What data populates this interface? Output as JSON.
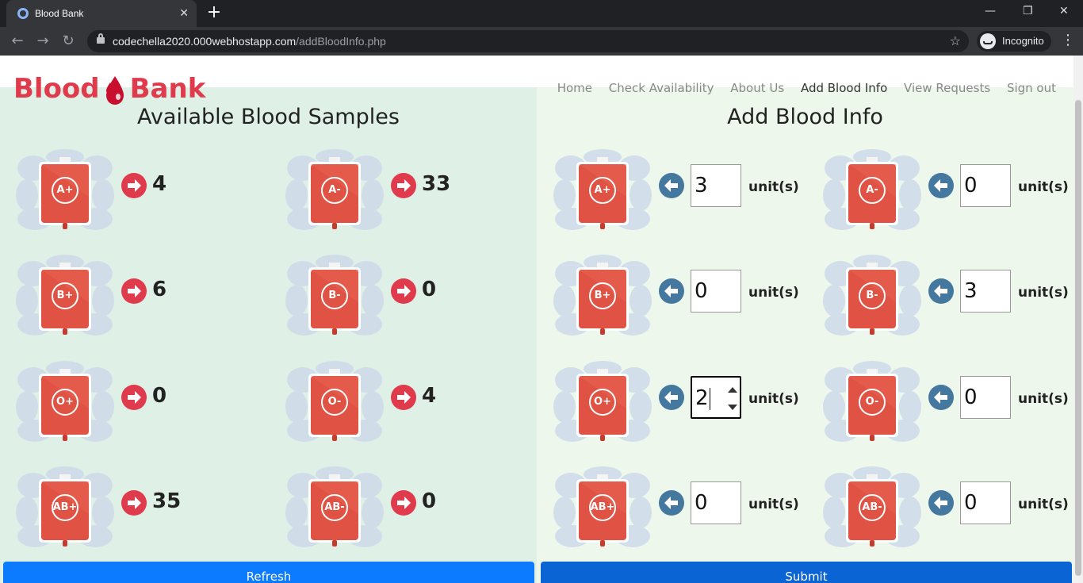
{
  "browser": {
    "tab_title": "Blood Bank",
    "tab_close": "✕",
    "new_tab": "+",
    "url_host": "codechella2020.000webhostapp.com",
    "url_path": "/addBloodInfo.php",
    "incognito_label": "Incognito",
    "window_controls": [
      "—",
      "❐",
      "✕"
    ]
  },
  "site": {
    "brand_left": "Blood",
    "brand_right": "Bank",
    "brand_color": "#e03a4d",
    "nav": [
      {
        "label": "Home",
        "active": false
      },
      {
        "label": "Check Availability",
        "active": false
      },
      {
        "label": "About Us",
        "active": false
      },
      {
        "label": "Add Blood Info",
        "active": true
      },
      {
        "label": "View Requests",
        "active": false
      },
      {
        "label": "Sign out",
        "active": false
      }
    ]
  },
  "available": {
    "title": "Available Blood Samples",
    "samples": [
      {
        "type": "A+",
        "count": "4"
      },
      {
        "type": "A-",
        "count": "33"
      },
      {
        "type": "B+",
        "count": "6"
      },
      {
        "type": "B-",
        "count": "0"
      },
      {
        "type": "O+",
        "count": "0"
      },
      {
        "type": "O-",
        "count": "4"
      },
      {
        "type": "AB+",
        "count": "35"
      },
      {
        "type": "AB-",
        "count": "0"
      }
    ],
    "refresh_label": "Refresh"
  },
  "add_info": {
    "title": "Add Blood Info",
    "unit_label": "unit(s)",
    "entries": [
      {
        "type": "A+",
        "value": "3"
      },
      {
        "type": "A-",
        "value": "0"
      },
      {
        "type": "B+",
        "value": "0"
      },
      {
        "type": "B-",
        "value": "3"
      },
      {
        "type": "O+",
        "value": "2"
      },
      {
        "type": "O-",
        "value": "0"
      },
      {
        "type": "AB+",
        "value": "0"
      },
      {
        "type": "AB-",
        "value": "0"
      }
    ],
    "submit_label": "Submit"
  },
  "colors": {
    "left_panel": "#dff0e6",
    "right_panel": "#eef7ec",
    "arrow_red": "#e03a4d",
    "arrow_blue": "#44789f",
    "refresh_button": "#0d7bff",
    "submit_button": "#0b64d4"
  },
  "icons": {
    "bag": "blood-bag-icon",
    "arrow_right": "arrow-right-circle-icon",
    "arrow_left": "arrow-left-circle-icon",
    "drop": "blood-drop-icon"
  }
}
